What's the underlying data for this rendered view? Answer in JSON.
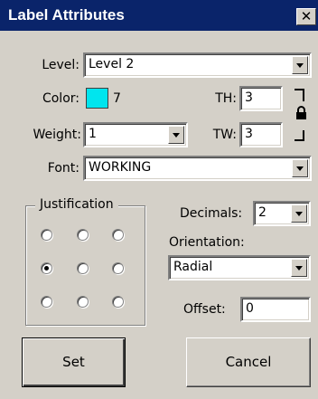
{
  "window": {
    "title": "Label Attributes",
    "close_glyph": "✕"
  },
  "level": {
    "label": "Level:",
    "value": "Level 2"
  },
  "color": {
    "label": "Color:",
    "swatch": "#00e5ee",
    "index": "7"
  },
  "th": {
    "label": "TH:",
    "value": "3"
  },
  "tw": {
    "label": "TW:",
    "value": "3"
  },
  "weight": {
    "label": "Weight:",
    "value": "1"
  },
  "font": {
    "label": "Font:",
    "value": "WORKING"
  },
  "justification": {
    "label": "Justification",
    "selected": "middle-left"
  },
  "decimals": {
    "label": "Decimals:",
    "value": "2"
  },
  "orientation": {
    "label": "Orientation:",
    "value": "Radial"
  },
  "offset": {
    "label": "Offset:",
    "value": "0"
  },
  "buttons": {
    "set": "Set",
    "cancel": "Cancel"
  },
  "icons": {
    "lock": "lock-icon",
    "dropdown": "chevron-down-icon"
  }
}
